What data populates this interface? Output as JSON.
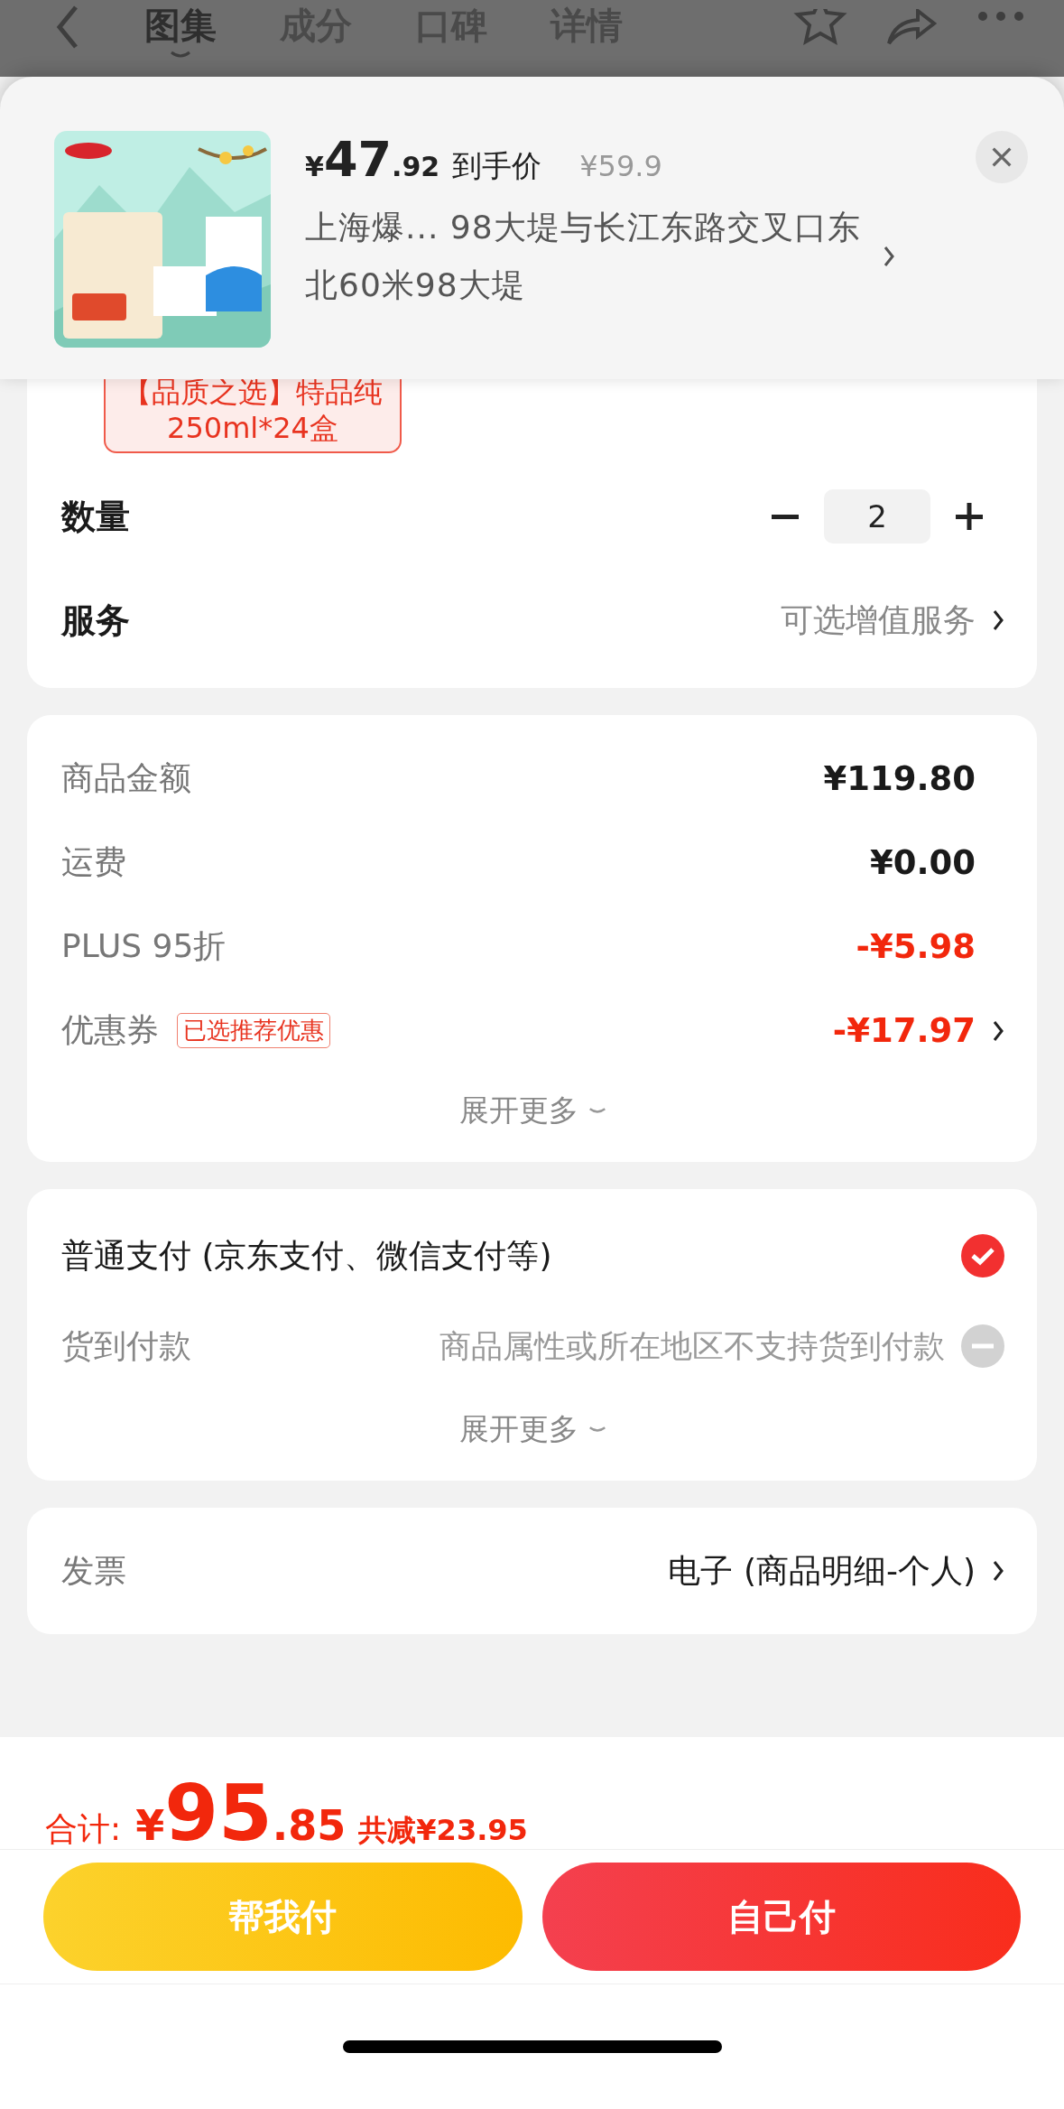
{
  "header": {
    "tabs": [
      {
        "label": "图集",
        "selected": true
      },
      {
        "label": "成分",
        "selected": false
      },
      {
        "label": "口碑",
        "selected": false
      },
      {
        "label": "详情",
        "selected": false
      }
    ]
  },
  "popup": {
    "currency": "¥",
    "price_integer": "47",
    "price_decimal": ".92",
    "price_label": "到手价",
    "original_price": "¥59.9",
    "address": "上海爆...  98大堤与长江东路交叉口东北60米98大堤"
  },
  "product_tag": {
    "line_1": "【品质之选】特品纯",
    "line_2": "250ml*24盒"
  },
  "quantity": {
    "label": "数量",
    "value": "2"
  },
  "service": {
    "label": "服务",
    "value": "可选增值服务"
  },
  "costs": [
    {
      "label": "商品金额",
      "value": "¥119.80",
      "kind": "amount",
      "arrow": false
    },
    {
      "label": "运费",
      "value": "¥0.00",
      "kind": "amount",
      "arrow": false
    },
    {
      "label": "PLUS 95折",
      "value": "-¥5.98",
      "kind": "discount",
      "arrow": false
    },
    {
      "label": "优惠券",
      "tag": "已选推荐优惠",
      "value": "-¥17.97",
      "kind": "discount",
      "arrow": true
    }
  ],
  "costs_expand": "展开更多",
  "payments": [
    {
      "label": "普通支付 (京东支付、微信支付等)",
      "selected": true,
      "disabled": false
    },
    {
      "label": "货到付款",
      "note": "商品属性或所在地区不支持货到付款",
      "selected": false,
      "disabled": true
    }
  ],
  "payments_expand": "展开更多",
  "invoice": {
    "label": "发票",
    "value": "电子 (商品明细-个人)"
  },
  "footer": {
    "total_label": "合计:",
    "currency": "¥",
    "total_integer": "95",
    "total_decimal": ".85",
    "saving": "共减¥23.95"
  },
  "buttons": [
    {
      "label": "帮我付",
      "kind": "friend"
    },
    {
      "label": "自己付",
      "kind": "self"
    }
  ]
}
